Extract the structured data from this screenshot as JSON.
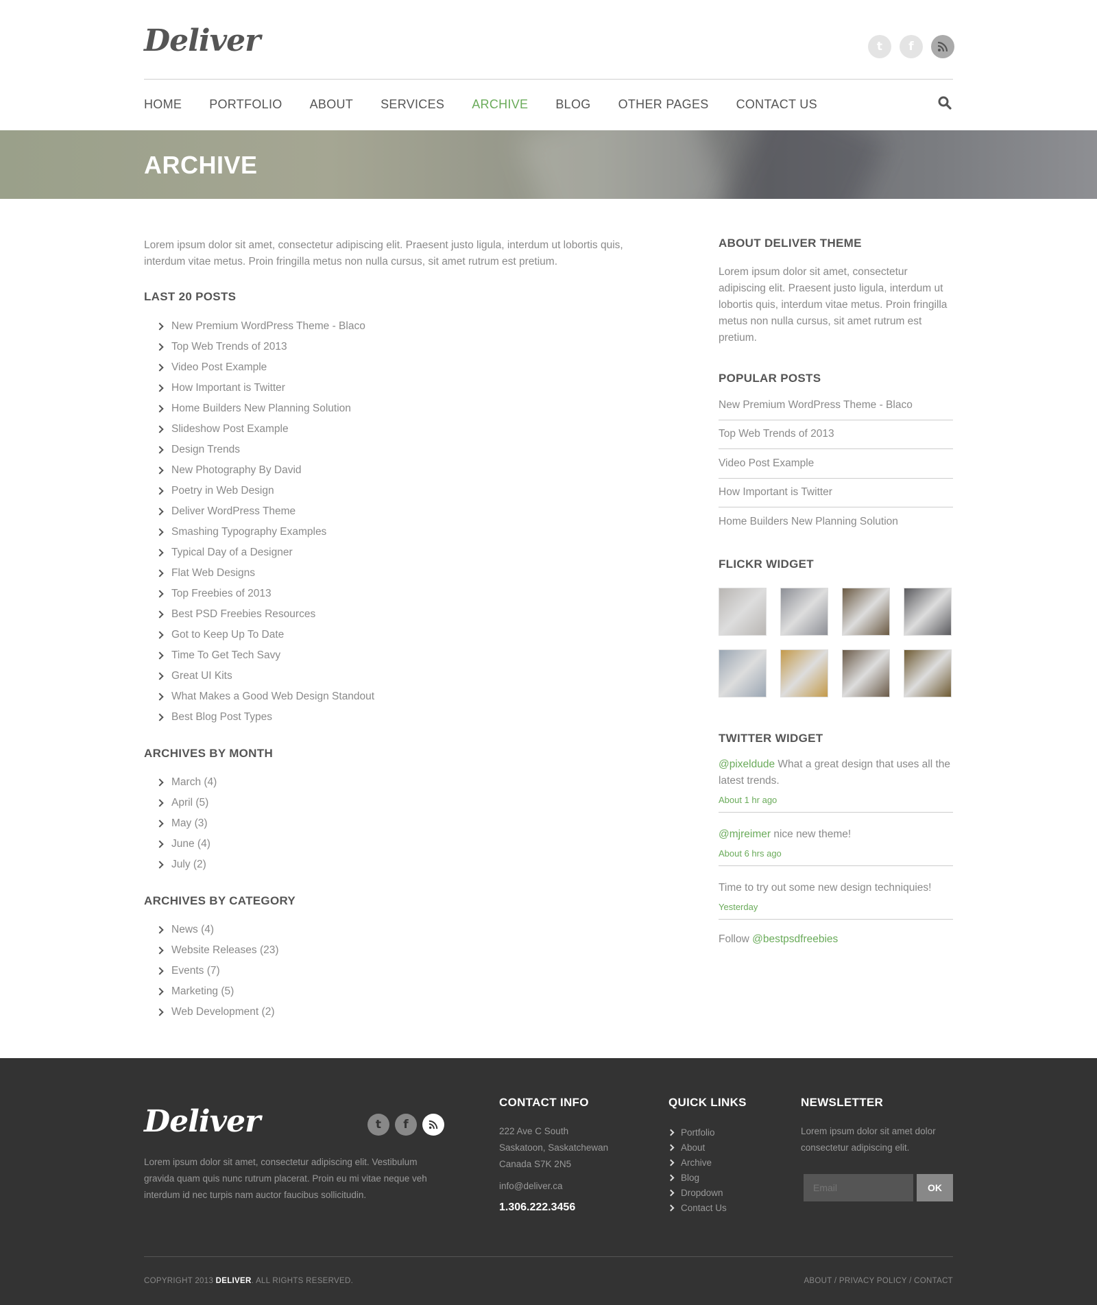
{
  "header": {
    "logo": "Deliver",
    "social": [
      {
        "icon": "twitter-icon",
        "glyph": "t"
      },
      {
        "icon": "facebook-icon",
        "glyph": "f"
      },
      {
        "icon": "rss-icon",
        "glyph": ")"
      }
    ],
    "nav": [
      {
        "label": "HOME",
        "active": false
      },
      {
        "label": "PORTFOLIO",
        "active": false
      },
      {
        "label": "ABOUT",
        "active": false
      },
      {
        "label": "SERVICES",
        "active": false
      },
      {
        "label": "ARCHIVE",
        "active": true
      },
      {
        "label": "BLOG",
        "active": false
      },
      {
        "label": "OTHER PAGES",
        "active": false
      },
      {
        "label": "CONTACT US",
        "active": false
      }
    ]
  },
  "banner": {
    "title": "ARCHIVE"
  },
  "main": {
    "intro": "Lorem ipsum dolor sit amet, consectetur adipiscing elit. Praesent justo ligula, interdum ut lobortis quis, interdum vitae metus. Proin fringilla metus non nulla cursus, sit amet rutrum est pretium.",
    "last_posts_title": "LAST 20 POSTS",
    "last_posts": [
      "New Premium WordPress Theme - Blaco",
      "Top Web Trends of 2013",
      "Video Post Example",
      "How Important is Twitter",
      "Home Builders New Planning Solution",
      "Slideshow Post Example",
      "Design Trends",
      "New Photography By David",
      "Poetry in Web Design",
      "Deliver WordPress Theme",
      "Smashing Typography Examples",
      "Typical Day of a Designer",
      "Flat Web Designs",
      "Top Freebies of 2013",
      "Best PSD Freebies Resources",
      "Got to Keep Up To Date",
      "Time To Get Tech Savy",
      "Great UI Kits",
      "What Makes a Good Web Design Standout",
      "Best Blog Post Types"
    ],
    "by_month_title": "ARCHIVES BY MONTH",
    "by_month": [
      "March (4)",
      "April (5)",
      "May (3)",
      "June (4)",
      "July (2)"
    ],
    "by_category_title": "ARCHIVES BY CATEGORY",
    "by_category": [
      "News (4)",
      "Website Releases (23)",
      "Events (7)",
      "Marketing (5)",
      "Web Development (2)"
    ]
  },
  "sidebar": {
    "about_title": "ABOUT DELIVER THEME",
    "about_text": "Lorem ipsum dolor sit amet, consectetur adipiscing elit. Praesent justo ligula, interdum ut lobortis quis, interdum vitae metus. Proin fringilla metus non nulla cursus, sit amet rutrum est pretium.",
    "popular_title": "POPULAR POSTS",
    "popular": [
      "New Premium WordPress Theme - Blaco",
      "Top Web Trends of 2013",
      "Video Post Example",
      "How Important is Twitter",
      "Home Builders New Planning Solution"
    ],
    "flickr_title": "FLICKR WIDGET",
    "flickr_colors": [
      "#b9b6b3",
      "#8d8f96",
      "#6b5a43",
      "#5a5a5e",
      "#9aa6b3",
      "#c49a4a",
      "#6a5a48",
      "#6e5a32"
    ],
    "twitter_title": "TWITTER WIDGET",
    "tweets": [
      {
        "handle": "@pixeldude",
        "text": " What a great design that uses all the latest trends.",
        "ago": "About 1 hr ago"
      },
      {
        "handle": "@mjreimer",
        "text": " nice new theme!",
        "ago": "About 6 hrs ago"
      },
      {
        "handle": "",
        "text": "Time to try out some new design techniquies!",
        "ago": "Yesterday"
      }
    ],
    "follow_prefix": "Follow ",
    "follow_handle": "@bestpsdfreebies"
  },
  "footer": {
    "logo": "Deliver",
    "text": "Lorem ipsum dolor sit amet, consectetur adipiscing elit. Vestibulum gravida quam quis nunc rutrum placerat. Proin eu mi vitae neque veh interdum id nec turpis nam auctor faucibus sollicitudin.",
    "contact_title": "CONTACT INFO",
    "address_line1": "222 Ave C South",
    "address_line2": "Saskatoon, Saskatchewan",
    "address_line3": "Canada S7K 2N5",
    "email": "info@deliver.ca",
    "phone": "1.306.222.3456",
    "quick_title": "QUICK LINKS",
    "quick_links": [
      "Portfolio",
      "About",
      "Archive",
      "Blog",
      "Dropdown",
      "Contact Us"
    ],
    "newsletter_title": "NEWSLETTER",
    "newsletter_text": "Lorem ipsum dolor sit amet dolor consectetur adipiscing elit.",
    "email_placeholder": "Email",
    "ok_label": "OK",
    "copyright_prefix": "COPYRIGHT 2013 ",
    "copyright_brand": "DELIVER",
    "copyright_suffix": ". ALL RIGHTS RESERVED.",
    "bottom_links": [
      "ABOUT",
      "PRIVACY POLICY",
      "CONTACT"
    ]
  },
  "colors": {
    "accent": "#6aab5a",
    "footer_bg": "#333333"
  }
}
